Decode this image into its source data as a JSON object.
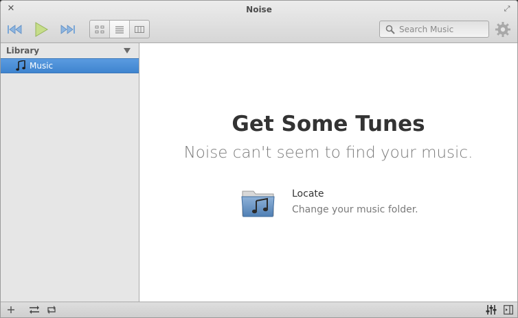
{
  "window": {
    "title": "Noise"
  },
  "toolbar": {
    "search_placeholder": "Search Music",
    "accent_color": "#3f84cf"
  },
  "sidebar": {
    "header": "Library",
    "items": [
      {
        "label": "Music",
        "icon": "music-note-icon",
        "selected": true
      }
    ]
  },
  "main": {
    "headline": "Get Some Tunes",
    "subline": "Noise can't seem to find your music.",
    "locate": {
      "title": "Locate",
      "subtitle": "Change your music folder.",
      "icon": "music-folder-icon"
    }
  }
}
